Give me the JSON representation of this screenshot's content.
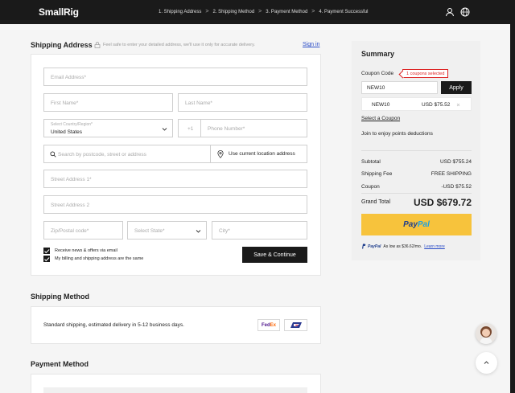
{
  "header": {
    "logo": "SmallRig",
    "steps": [
      "1. Shipping Address",
      "2. Shipping Method",
      "3. Payment Method",
      "4. Payment Successful"
    ],
    "separator": ">"
  },
  "shipping_address": {
    "title": "Shipping Address",
    "hint": "Feel safe to enter your detailed address, we'll use it only for accurate delivery.",
    "sign_in": "Sign in",
    "email_placeholder": "Email Address*",
    "first_name_placeholder": "First Name*",
    "last_name_placeholder": "Last Name*",
    "country_label": "Select Country/Region*",
    "country_value": "United States",
    "phone_code": "+1",
    "phone_placeholder": "Phone Number*",
    "search_placeholder": "Search by postcode, street or address",
    "use_location": "Use current location address",
    "street1_placeholder": "Street Address 1*",
    "street2_placeholder": "Street Address 2",
    "zip_placeholder": "Zip/Postal code*",
    "state_placeholder": "Select State*",
    "city_placeholder": "City*",
    "check_news": "Receive news & offers via email",
    "check_billing": "My billing and shipping address are the same",
    "save_button": "Save & Continue"
  },
  "shipping_method": {
    "title": "Shipping Method",
    "text": "Standard shipping, estimated delivery in 5-12 business days.",
    "fedex_fd": "Fed",
    "fedex_ex": "Ex"
  },
  "payment_method": {
    "title": "Payment Method"
  },
  "summary": {
    "title": "Summary",
    "coupon_code_label": "Coupon Code",
    "coupons_selected": "1 coupons selected",
    "coupon_input_value": "NEW10",
    "apply_button": "Apply",
    "coupon_item_code": "NEW10",
    "coupon_item_amount": "USD $75.52",
    "select_coupon": "Select a Coupon",
    "points_text": "Join to enjoy points deductions",
    "subtotal_label": "Subtotal",
    "subtotal_value": "USD $755.24",
    "shipping_fee_label": "Shipping Fee",
    "shipping_fee_value": "FREE SHIPPING",
    "coupon_label": "Coupon",
    "coupon_value": "-USD $75.52",
    "grand_total_label": "Grand Total",
    "grand_total_value": "USD $679.72",
    "paypal_pay": "Pay",
    "paypal_pal": "Pal",
    "paypal_note_brand": "PayPal",
    "paypal_note": "As low as $36.62/mo.",
    "learn_more": "Learn more"
  },
  "colors": {
    "header_bg": "#1a1a1a",
    "paypal_yellow": "#f7c33c",
    "accent_red": "#dd2222",
    "link_blue": "#2a4cc7"
  }
}
